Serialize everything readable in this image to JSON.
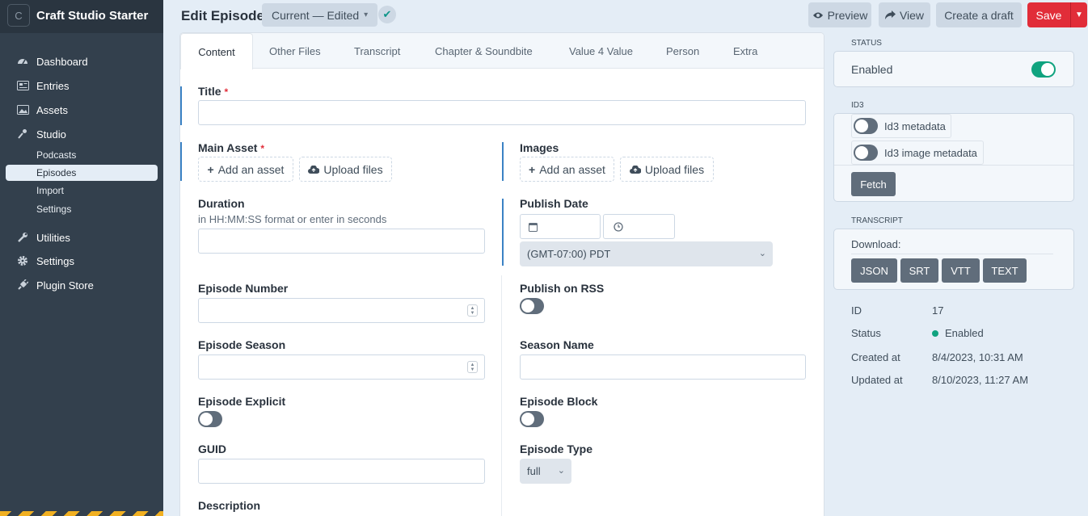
{
  "site": {
    "logo_letter": "C",
    "name": "Craft Studio Starter"
  },
  "nav": {
    "dashboard": "Dashboard",
    "entries": "Entries",
    "assets": "Assets",
    "studio": "Studio",
    "studio_sub": {
      "podcasts": "Podcasts",
      "episodes": "Episodes",
      "import": "Import",
      "settings": "Settings"
    },
    "utilities": "Utilities",
    "settings": "Settings",
    "plugin_store": "Plugin Store"
  },
  "header": {
    "title": "Edit Episode",
    "revision": "Current — Edited",
    "preview": "Preview",
    "view": "View",
    "create_draft": "Create a draft",
    "save": "Save"
  },
  "tabs": [
    "Content",
    "Other Files",
    "Transcript",
    "Chapter & Soundbite",
    "Value 4 Value",
    "Person",
    "Extra"
  ],
  "fields": {
    "title": {
      "label": "Title",
      "required": "*"
    },
    "main_asset": {
      "label": "Main Asset",
      "required": "*",
      "add": "Add an asset",
      "upload": "Upload files"
    },
    "images": {
      "label": "Images",
      "add": "Add an asset",
      "upload": "Upload files"
    },
    "duration": {
      "label": "Duration",
      "instructions": "in HH:MM:SS format or enter in seconds"
    },
    "publish_date": {
      "label": "Publish Date",
      "timezone": "(GMT-07:00) PDT"
    },
    "episode_number": {
      "label": "Episode Number"
    },
    "publish_on_rss": {
      "label": "Publish on RSS"
    },
    "episode_season": {
      "label": "Episode Season"
    },
    "season_name": {
      "label": "Season Name"
    },
    "episode_explicit": {
      "label": "Episode Explicit"
    },
    "episode_block": {
      "label": "Episode Block"
    },
    "guid": {
      "label": "GUID"
    },
    "episode_type": {
      "label": "Episode Type",
      "value": "full"
    },
    "description": {
      "label": "Description"
    }
  },
  "sidebar_right": {
    "status_heading": "Status",
    "enabled_label": "Enabled",
    "id3_heading": "ID3",
    "id3_metadata": "Id3 metadata",
    "id3_image_metadata": "Id3 image metadata",
    "fetch": "Fetch",
    "transcript_heading": "Transcript",
    "download_label": "Download:",
    "formats": [
      "JSON",
      "SRT",
      "VTT",
      "TEXT"
    ]
  },
  "meta": {
    "id_label": "ID",
    "id_value": "17",
    "status_label": "Status",
    "status_value": "Enabled",
    "created_label": "Created at",
    "created_value": "8/4/2023, 10:31 AM",
    "updated_label": "Updated at",
    "updated_value": "8/10/2023, 11:27 AM"
  },
  "colors": {
    "sidebar": "#33404d",
    "accent": "#e12d39",
    "toggle_on": "#10a37f",
    "status_green": "#10a37f"
  }
}
